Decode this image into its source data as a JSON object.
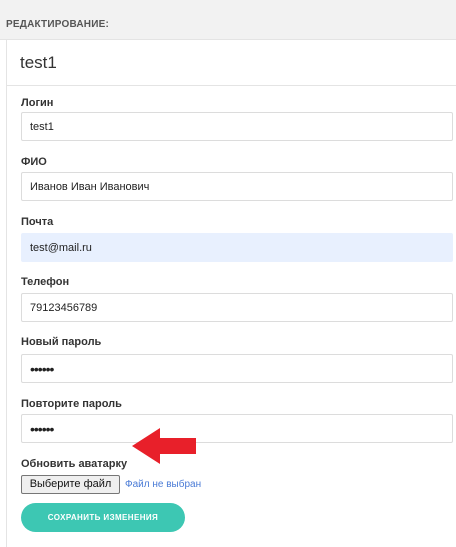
{
  "header": {
    "title": "РЕДАКТИРОВАНИЕ:"
  },
  "panel": {
    "title": "test1"
  },
  "form": {
    "login": {
      "label": "Логин",
      "value": "test1"
    },
    "fio": {
      "label": "ФИО",
      "value": "Иванов Иван Иванович"
    },
    "email": {
      "label": "Почта",
      "value": "test@mail.ru"
    },
    "phone": {
      "label": "Телефон",
      "value": "79123456789"
    },
    "new_password": {
      "label": "Новый пароль",
      "value": "••••••"
    },
    "repeat_password": {
      "label": "Повторите пароль",
      "value": "••••••"
    },
    "avatar": {
      "label": "Обновить аватарку",
      "button_label": "Выберите файл",
      "status": "Файл не выбран"
    },
    "save_label": "СОХРАНИТЬ ИЗМЕНЕНИЯ"
  },
  "colors": {
    "accent": "#3dc7b3",
    "autofill": "#e8f0fe",
    "annotation_arrow": "#e8202a",
    "link": "#4a7bd6"
  },
  "icons": {
    "annotation": "red-arrow-icon"
  }
}
